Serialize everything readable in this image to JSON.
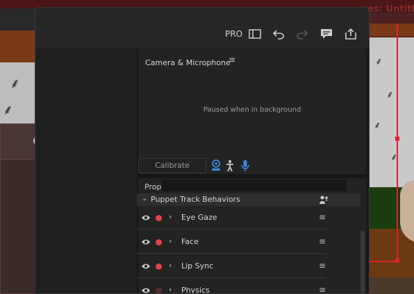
{
  "background_window": {
    "title_fragment": "nes: Untitle"
  },
  "toolbar": {
    "pro_label": "PRO",
    "icons": [
      "panel-layout-icon",
      "undo-icon",
      "redo-icon",
      "comment-icon",
      "share-icon"
    ]
  },
  "camera": {
    "title": "Camera & Microphone",
    "menu_glyph": "≡",
    "status": "Paused when in background",
    "calibrate_label": "Calibrate",
    "controls": [
      "face-camera-icon",
      "body-tracking-icon",
      "microphone-icon"
    ]
  },
  "properties": {
    "label": "Prop",
    "value": "",
    "group": {
      "label": "Puppet Track Behaviors",
      "collapsed": false
    },
    "behaviors": [
      {
        "label": "Eye Gaze",
        "armed": true
      },
      {
        "label": "Face",
        "armed": true
      },
      {
        "label": "Lip Sync",
        "armed": true
      },
      {
        "label": "Physics",
        "armed": false
      }
    ],
    "row_menu_glyph": "≡",
    "expand_glyph": "›"
  },
  "colors": {
    "accent_blue": "#3a8ee6",
    "arm_red": "#e2434b",
    "arm_dim": "#5a2a2c",
    "selection_red": "#e0202a"
  }
}
